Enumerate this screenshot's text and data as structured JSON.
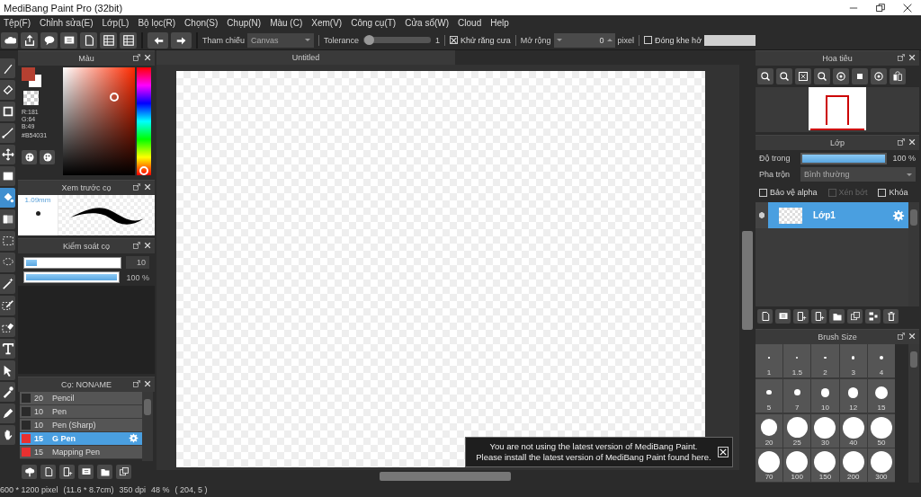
{
  "window": {
    "title": "MediBang Paint Pro (32bit)"
  },
  "menu": [
    "Tệp(F)",
    "Chỉnh sửa(E)",
    "Lớp(L)",
    "Bộ lọc(R)",
    "Chọn(S)",
    "Chụp(N)",
    "Màu (C)",
    "Xem(V)",
    "Công cụ(T)",
    "Cửa sổ(W)",
    "Cloud",
    "Help"
  ],
  "toolbar": {
    "reference_label": "Tham chiếu",
    "reference_value": "Canvas",
    "tolerance_label": "Tolerance",
    "tolerance": {
      "level": 0.02,
      "value": "1"
    },
    "antialias": {
      "label": "Khử răng cưa",
      "checked": true
    },
    "expand_label": "Mở rộng",
    "expand_value": "0",
    "expand_unit": "pixel",
    "close_gap": {
      "label": "Đóng khe hở",
      "checked": false
    }
  },
  "tools": [
    {
      "kind": "brush",
      "selected": false
    },
    {
      "kind": "eraser",
      "selected": false
    },
    {
      "kind": "rect",
      "selected": false
    },
    {
      "kind": "line",
      "selected": false
    },
    {
      "kind": "move",
      "selected": false
    },
    {
      "kind": "fill",
      "selected": false
    },
    {
      "kind": "bucket",
      "selected": true
    },
    {
      "kind": "gradient",
      "selected": false
    },
    {
      "kind": "select",
      "selected": false
    },
    {
      "kind": "lasso",
      "selected": false
    },
    {
      "kind": "wand",
      "selected": false
    },
    {
      "kind": "selpen",
      "selected": false
    },
    {
      "kind": "selerase",
      "selected": false
    },
    {
      "kind": "text",
      "selected": false
    },
    {
      "kind": "operation",
      "selected": false
    },
    {
      "kind": "dropper",
      "selected": false
    },
    {
      "kind": "pen",
      "selected": false
    },
    {
      "kind": "hand",
      "selected": false
    }
  ],
  "color_panel": {
    "title": "Màu",
    "r": "R:181",
    "g": "G:64",
    "b": "B:49",
    "hex": "#B54031"
  },
  "brush_preview": {
    "title": "Xem trước cọ",
    "size": "1.09mm"
  },
  "brush_control": {
    "title": "Kiểm soát cọ",
    "size": {
      "level": 0.12,
      "value": "10"
    },
    "opacity": {
      "level": 1,
      "value": "100 %"
    }
  },
  "brush_list": {
    "title": "Cọ: NONAME",
    "items": [
      {
        "size": "20",
        "name": "Pencil",
        "color": "#2a2a2a",
        "selected": false
      },
      {
        "size": "10",
        "name": "Pen",
        "color": "#2a2a2a",
        "selected": false
      },
      {
        "size": "10",
        "name": "Pen (Sharp)",
        "color": "#2a2a2a",
        "selected": false
      },
      {
        "size": "15",
        "name": "G Pen",
        "color": "#e83030",
        "selected": true
      },
      {
        "size": "15",
        "name": "Mapping Pen",
        "color": "#e83030",
        "selected": false
      }
    ]
  },
  "canvas": {
    "tab": "Untitled"
  },
  "notification": {
    "lines": [
      "You are not using the latest version of MediBang Paint.",
      "Please install the latest version of MediBang Paint found here."
    ]
  },
  "navigator": {
    "title": "Hoa tiêu"
  },
  "layers": {
    "title": "Lớp",
    "opacity_label": "Độ trong",
    "opacity": {
      "level": 1,
      "value": "100 %"
    },
    "blend_label": "Pha trộn",
    "blend_value": "Bình thường",
    "options": [
      {
        "label": "Bảo vệ alpha",
        "checked": false,
        "disabled": false
      },
      {
        "label": "Xén bớt",
        "checked": false,
        "disabled": true
      },
      {
        "label": "Khóa",
        "checked": false,
        "disabled": false
      }
    ],
    "items": [
      {
        "name": "Lớp1",
        "selected": true,
        "visible": true
      }
    ]
  },
  "brush_size": {
    "title": "Brush Size",
    "sizes": [
      "1",
      "1.5",
      "2",
      "3",
      "4",
      "5",
      "7",
      "10",
      "12",
      "15",
      "20",
      "25",
      "30",
      "40",
      "50",
      "70",
      "100",
      "150",
      "200",
      "300"
    ]
  },
  "status_bar": [
    "600 * 1200 pixel",
    "(11.6 * 8.7cm)",
    "350 dpi",
    "48 %",
    "( 204, 5 )"
  ]
}
